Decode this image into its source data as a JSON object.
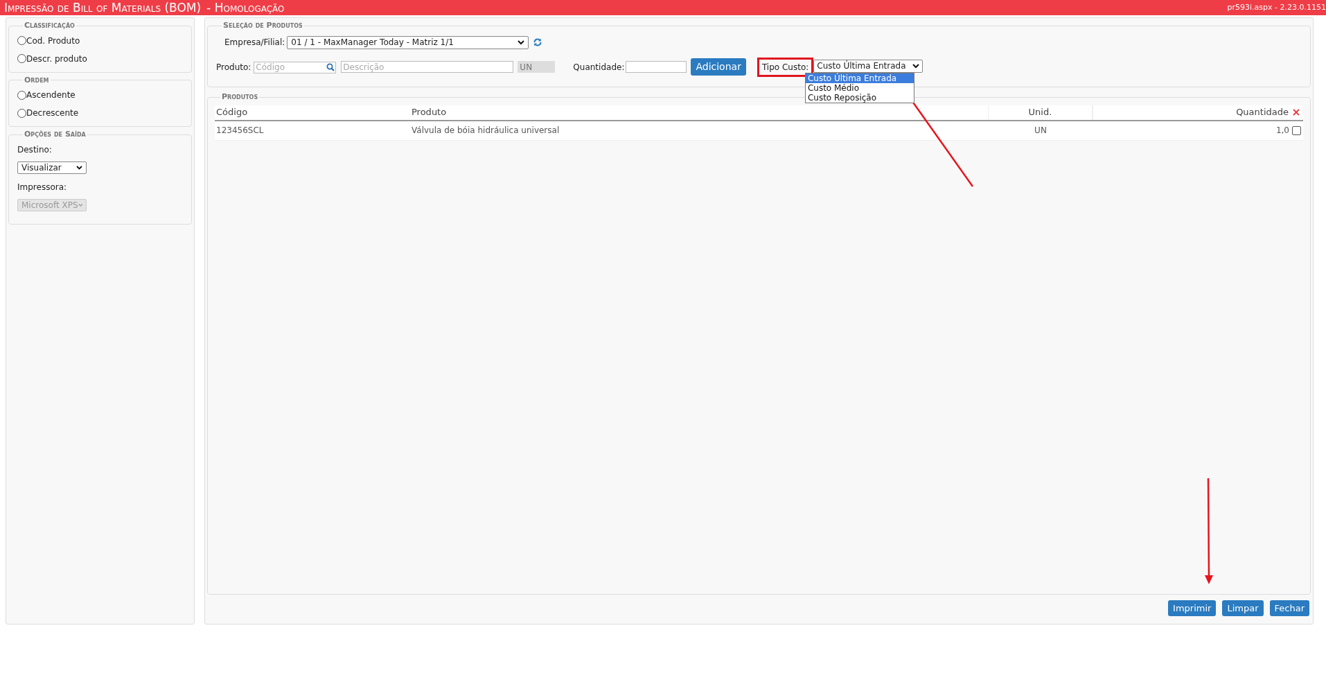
{
  "title_bar": {
    "title": "Impressão de Bill of Materials (BOM)",
    "environment": "- Homologação",
    "version": "pr593i.aspx - 2.23.0.1151"
  },
  "sidebar": {
    "groups": [
      {
        "title": "Classificação",
        "kind": "radios",
        "items": [
          {
            "label": "Cod. Produto",
            "selected": false
          },
          {
            "label": "Descr. produto",
            "selected": false
          }
        ]
      },
      {
        "title": "Ordem",
        "kind": "radios",
        "items": [
          {
            "label": "Ascendente",
            "selected": false
          },
          {
            "label": "Decrescente",
            "selected": false
          }
        ]
      },
      {
        "title": "Opções de Saída",
        "kind": "selects",
        "fields": [
          {
            "label": "Destino:",
            "value": "Visualizar",
            "disabled": false
          },
          {
            "label": "Impressora:",
            "value": "Microsoft XPS",
            "disabled": true
          }
        ]
      }
    ]
  },
  "selection": {
    "title": "Seleção de Produtos",
    "empresa": {
      "label": "Empresa/Filial:",
      "value": "01 / 1 - MaxManager Today - Matriz 1/1"
    },
    "produto": {
      "label": "Produto:",
      "code_placeholder": "Código",
      "description_placeholder": "Descrição",
      "unit": "UN"
    },
    "quantidade": {
      "label": "Quantidade:"
    },
    "add_button": "Adicionar",
    "tipo_custo": {
      "label": "Tipo Custo:",
      "highlighted": true,
      "value": "Custo Última Entrada",
      "expanded": true,
      "options": [
        {
          "label": "Custo Última Entrada",
          "selected": true
        },
        {
          "label": "Custo Médio",
          "selected": false
        },
        {
          "label": "Custo Reposição",
          "selected": false
        }
      ]
    }
  },
  "products": {
    "title": "Produtos",
    "columns": [
      "Código",
      "Produto",
      "Unid.",
      "Quantidade"
    ],
    "rows": [
      {
        "code": "123456SCL",
        "product": "Válvula de bóia hidráulica universal",
        "unit": "UN",
        "quantity": "1,0",
        "checked": false
      }
    ]
  },
  "buttons": [
    "Imprimir",
    "Limpar",
    "Fechar"
  ]
}
